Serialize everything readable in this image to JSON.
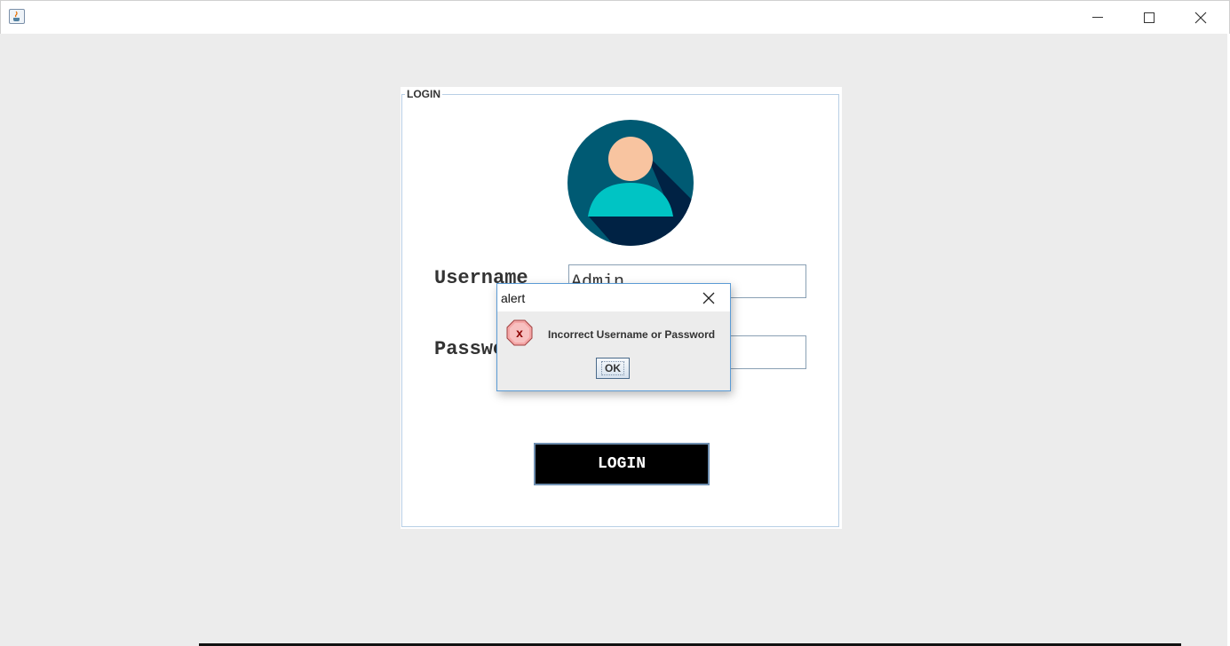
{
  "window": {
    "app_icon": "java-cup-icon",
    "controls": {
      "minimize": "minimize-icon",
      "maximize": "maximize-icon",
      "close": "close-icon"
    }
  },
  "login_panel": {
    "legend": "LOGIN",
    "avatar": "user-avatar-icon",
    "username_label": "Username",
    "username_value": "Admin",
    "password_label": "Password",
    "password_value": "",
    "login_button": "LOGIN"
  },
  "dialog": {
    "title": "alert",
    "message": "Incorrect Username or Password",
    "icon": "error-icon",
    "ok_button": "OK"
  },
  "colors": {
    "avatar_circle": "#005a73",
    "avatar_shadow": "#002244",
    "avatar_face": "#f8c4a0",
    "avatar_body": "#00c4c4",
    "login_button_bg": "#000000",
    "dialog_border": "#5b9bd5"
  }
}
